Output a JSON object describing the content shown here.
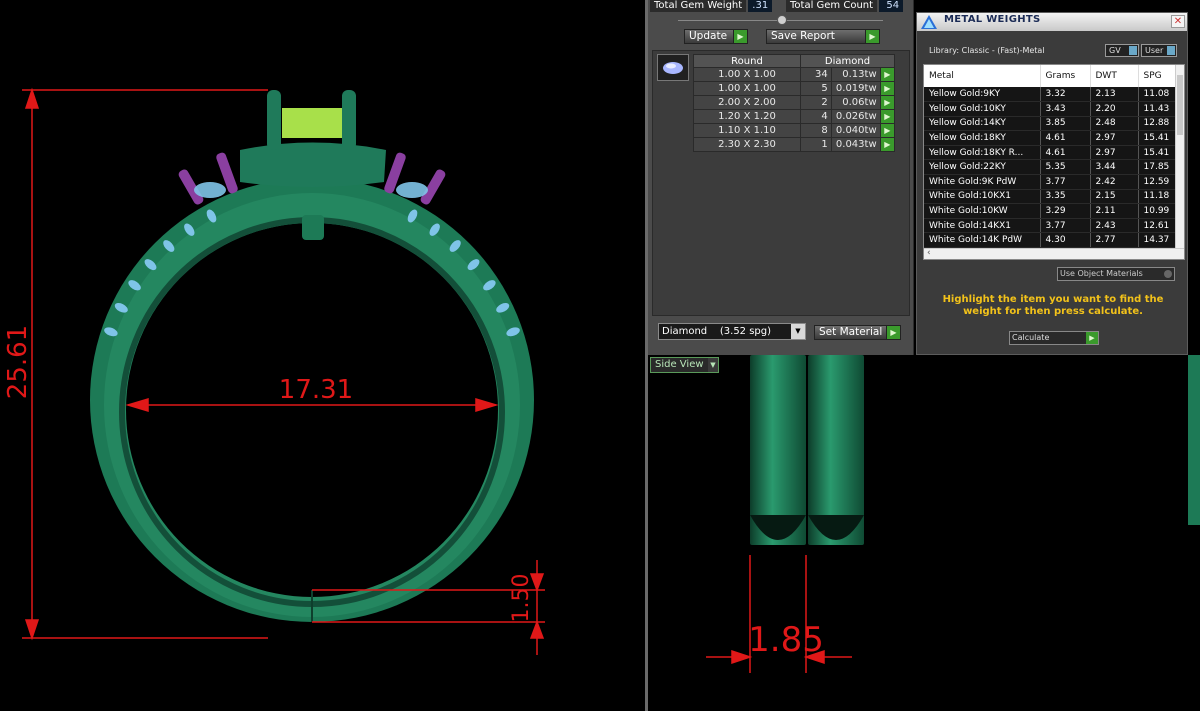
{
  "gem_summary": {
    "total_weight_label": "Total Gem Weight",
    "total_weight_value": ".31",
    "total_count_label": "Total Gem Count",
    "total_count_value": "54"
  },
  "buttons": {
    "update": "Update",
    "save_report": "Save Report",
    "set_material": "Set Material"
  },
  "gem_table": {
    "headers": [
      "Round",
      "Diamond"
    ],
    "rows": [
      {
        "size": "1.00 X 1.00",
        "count": "34",
        "weight": "0.13tw"
      },
      {
        "size": "1.00 X 1.00",
        "count": "5",
        "weight": "0.019tw"
      },
      {
        "size": "2.00 X 2.00",
        "count": "2",
        "weight": "0.06tw"
      },
      {
        "size": "1.20 X 1.20",
        "count": "4",
        "weight": "0.026tw"
      },
      {
        "size": "1.10 X 1.10",
        "count": "8",
        "weight": "0.040tw"
      },
      {
        "size": "2.30 X 2.30",
        "count": "1",
        "weight": "0.043tw"
      }
    ]
  },
  "material_select": {
    "value": "Diamond",
    "spg": "(3.52 spg)"
  },
  "metal_panel": {
    "title": "METAL WEIGHTS",
    "close": "✕",
    "library": "Library: Classic - (Fast)-Metal",
    "gv_label": "GV",
    "user_label": "User",
    "columns": [
      "Metal",
      "Grams",
      "DWT",
      "SPG"
    ],
    "rows": [
      {
        "metal": "Yellow Gold:9KY",
        "grams": "3.32",
        "dwt": "2.13",
        "spg": "11.08"
      },
      {
        "metal": "Yellow Gold:10KY",
        "grams": "3.43",
        "dwt": "2.20",
        "spg": "11.43"
      },
      {
        "metal": "Yellow Gold:14KY",
        "grams": "3.85",
        "dwt": "2.48",
        "spg": "12.88"
      },
      {
        "metal": "Yellow Gold:18KY",
        "grams": "4.61",
        "dwt": "2.97",
        "spg": "15.41"
      },
      {
        "metal": "Yellow Gold:18KY R...",
        "grams": "4.61",
        "dwt": "2.97",
        "spg": "15.41"
      },
      {
        "metal": "Yellow Gold:22KY",
        "grams": "5.35",
        "dwt": "3.44",
        "spg": "17.85"
      },
      {
        "metal": "White Gold:9K PdW",
        "grams": "3.77",
        "dwt": "2.42",
        "spg": "12.59"
      },
      {
        "metal": "White Gold:10KX1",
        "grams": "3.35",
        "dwt": "2.15",
        "spg": "11.18"
      },
      {
        "metal": "White Gold:10KW",
        "grams": "3.29",
        "dwt": "2.11",
        "spg": "10.99"
      },
      {
        "metal": "White Gold:14KX1",
        "grams": "3.77",
        "dwt": "2.43",
        "spg": "12.61"
      },
      {
        "metal": "White Gold:14K PdW",
        "grams": "4.30",
        "dwt": "2.77",
        "spg": "14.37"
      }
    ],
    "use_object_materials": "Use Object Materials",
    "hint": "Highlight the item you want to find the weight for then press calculate.",
    "calculate": "Calculate"
  },
  "side_view": {
    "label": "Side View"
  },
  "dimensions": {
    "height": "25.61",
    "inner_diameter": "17.31",
    "band_thickness": "1.50",
    "band_width": "1.85"
  },
  "colors": {
    "metal": "#1f7a5a",
    "gem": "#7fc4e8",
    "prong": "#8a3fa0",
    "center_stone": "#a8e04a",
    "dimension": "#e01818",
    "hint": "#f2c21a",
    "go_button": "#3a9a2c"
  }
}
